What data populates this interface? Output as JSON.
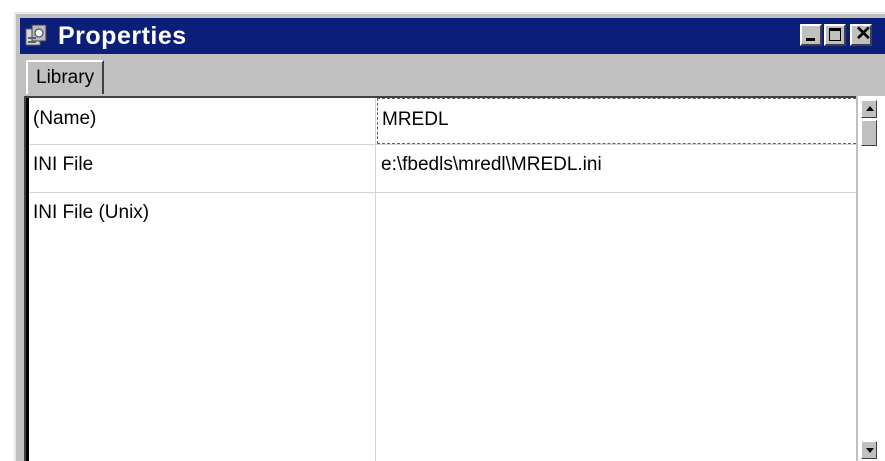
{
  "window": {
    "title": "Properties",
    "icon": "properties-icon",
    "buttons": {
      "minimize": "minimize-icon",
      "maximize": "maximize-icon",
      "close": "close-icon"
    }
  },
  "tabs": [
    {
      "label": "Library"
    }
  ],
  "properties": [
    {
      "name": "(Name)",
      "value": "MREDL"
    },
    {
      "name": "INI File",
      "value": "e:\\fbedls\\mredl\\MREDL.ini"
    },
    {
      "name": "INI File (Unix)",
      "value": ""
    }
  ],
  "colors": {
    "titlebar": "#0a1e7a",
    "face": "#c0c0c0",
    "grid_bg": "#ffffff"
  }
}
